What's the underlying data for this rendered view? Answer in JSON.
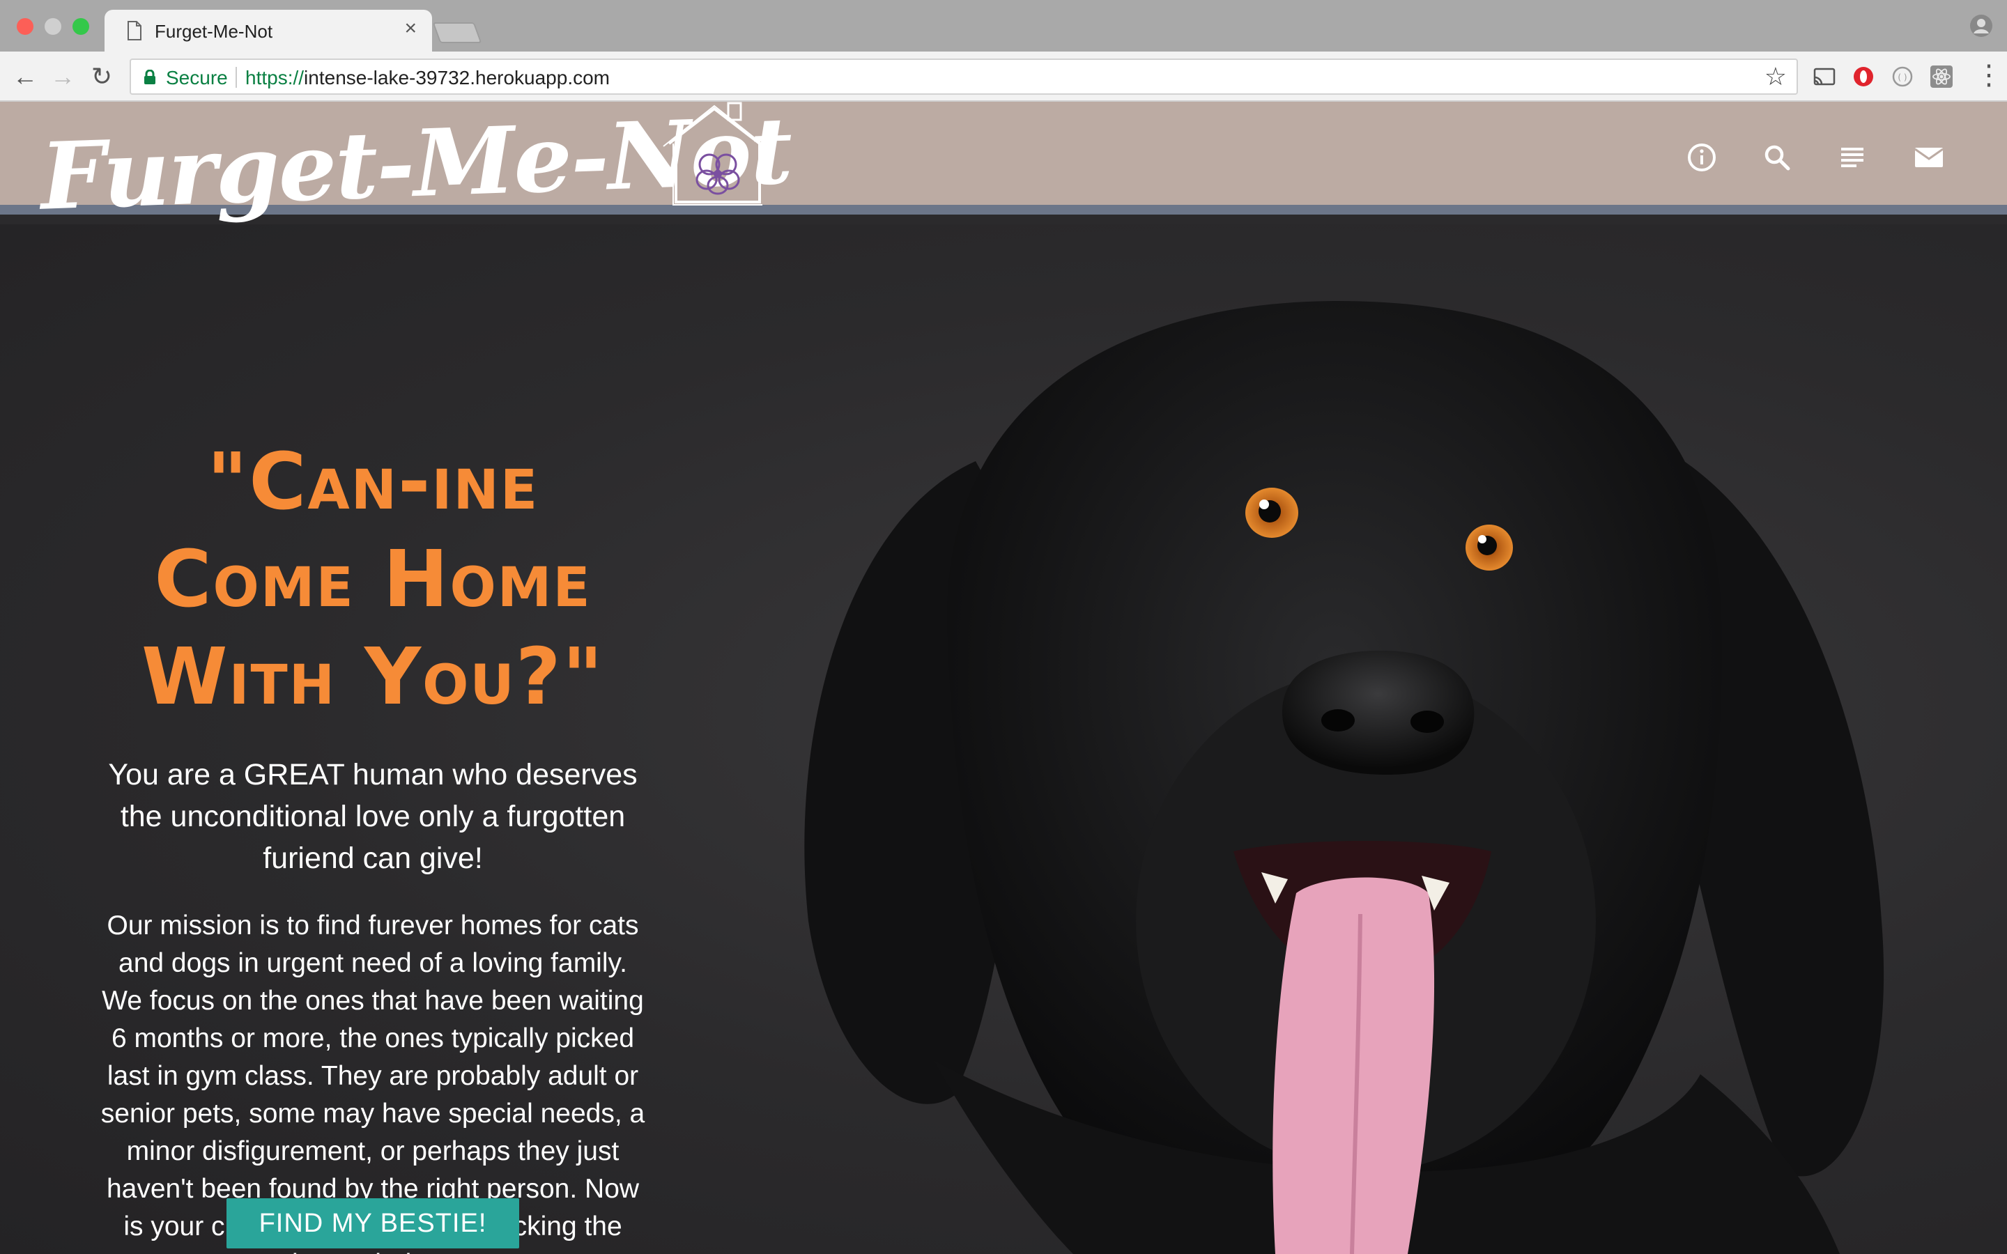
{
  "browser": {
    "tab_title": "Furget-Me-Not",
    "tab_close": "×",
    "secure_label": "Secure",
    "url_scheme": "https://",
    "url_host": "intense-lake-39732.herokuapp.com",
    "star": "☆",
    "menu": "⋮",
    "back": "←",
    "forward": "→",
    "reload": "↻"
  },
  "header": {
    "logo": "Furget-Me-Not",
    "icons": [
      "info-icon",
      "search-icon",
      "list-icon",
      "mail-icon"
    ]
  },
  "hero": {
    "headline": "\"Can-ine Come Home With You?\"",
    "lead": "You are a GREAT human who deserves the unconditional love only a furgotten furiend can give!",
    "mission": "Our mission is to find furever homes for cats and dogs in urgent need of a loving family. We focus on the ones that have been waiting 6 months or more, the ones typically picked last in gym class. They are probably adult or senior pets, some may have special needs, a minor disfigurement, or perhaps they just haven't been found by the right person. Now is your chance. Help today by clicking the button below!",
    "cta": "FIND MY BESTIE!"
  },
  "colors": {
    "header_bg": "#bcaba3",
    "header_rule": "#6c7689",
    "headline": "#f68b37",
    "cta_bg": "#2aa59a",
    "page_bg": "#2b2a2c"
  }
}
